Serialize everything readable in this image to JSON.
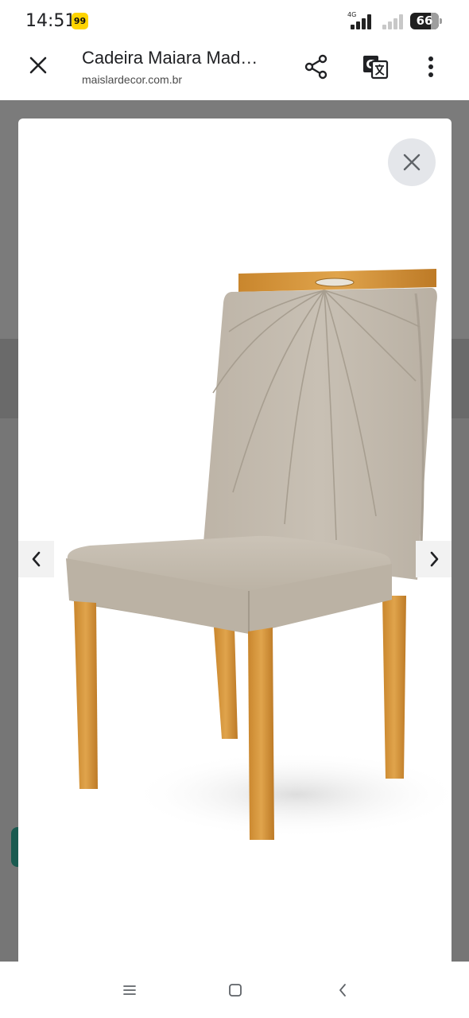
{
  "status_bar": {
    "time": "14:51",
    "app_badge": "99",
    "network": "4G",
    "battery_level": "66"
  },
  "toolbar": {
    "title": "Cadeira Maiara Mad…",
    "domain": "maislardecor.com.br",
    "close_icon": "close-icon",
    "share_icon": "share-icon",
    "translate_icon": "translate-icon",
    "menu_icon": "more-vert-icon"
  },
  "viewer": {
    "image_description_icon": "chair-image",
    "close_icon": "close-icon",
    "prev_icon": "chevron-left-icon",
    "next_icon": "chevron-right-icon"
  },
  "system_nav": {
    "recents_icon": "recents-icon",
    "home_icon": "home-icon",
    "back_icon": "back-icon"
  },
  "colors": {
    "chair_fabric": "#c4bcb0",
    "chair_wood": "#d79a3f",
    "overlay": "#7b7b7b",
    "viewer_close_bg": "#e4e6ea"
  }
}
